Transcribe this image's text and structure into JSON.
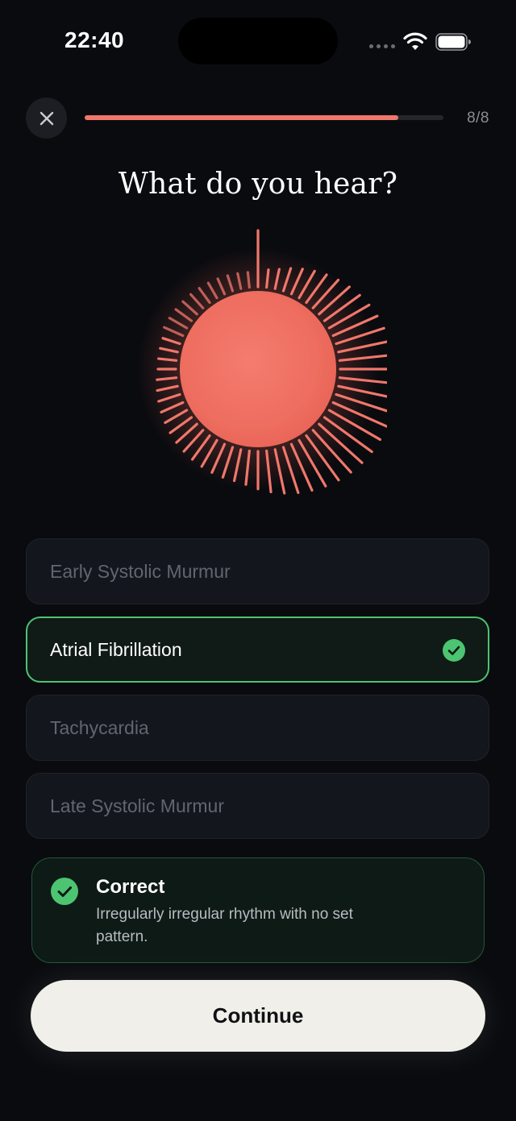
{
  "status_bar": {
    "time": "22:40"
  },
  "header": {
    "close_icon": "close-icon",
    "progress_text": "8/8",
    "progress_fraction": 0.875
  },
  "question": "What do you hear?",
  "options": [
    {
      "label": "Early Systolic Murmur",
      "state": "default"
    },
    {
      "label": "Atrial Fibrillation",
      "state": "correct"
    },
    {
      "label": "Tachycardia",
      "state": "default"
    },
    {
      "label": "Late Systolic Murmur",
      "state": "default"
    }
  ],
  "feedback": {
    "title": "Correct",
    "text": "Irregularly irregular rhythm with no set pattern.",
    "icon": "check-circle-icon"
  },
  "continue_label": "Continue",
  "colors": {
    "accent": "#f0776b",
    "success": "#4cc471",
    "background": "#0a0b0f"
  }
}
